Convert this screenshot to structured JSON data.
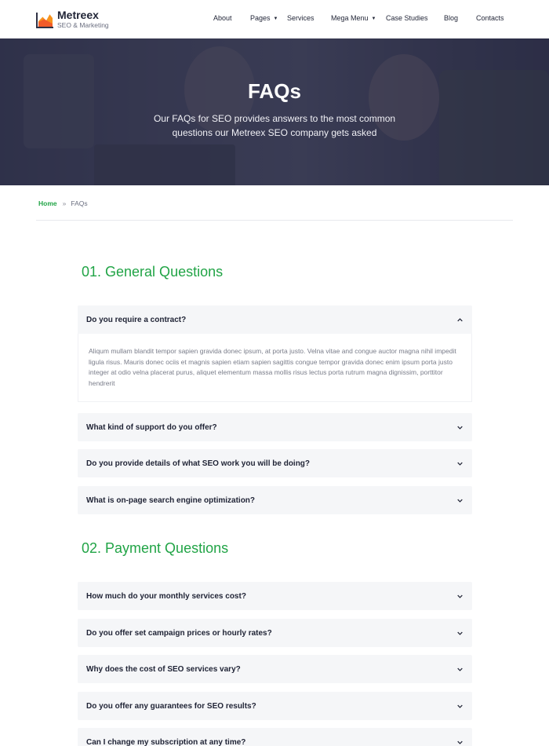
{
  "brand": {
    "title": "Metreex",
    "subtitle": "SEO & Marketing"
  },
  "nav": [
    {
      "label": "About",
      "has_caret": false
    },
    {
      "label": "Pages",
      "has_caret": true
    },
    {
      "label": "Services",
      "has_caret": false
    },
    {
      "label": "Mega Menu",
      "has_caret": true
    },
    {
      "label": "Case Studies",
      "has_caret": false
    },
    {
      "label": "Blog",
      "has_caret": false
    },
    {
      "label": "Contacts",
      "has_caret": false
    }
  ],
  "hero": {
    "title": "FAQs",
    "subtitle": "Our FAQs for SEO provides answers to the most common questions our Metreex SEO company gets asked"
  },
  "breadcrumb": {
    "home": "Home",
    "separator": "»",
    "current": "FAQs"
  },
  "sections": [
    {
      "title": "01. General Questions",
      "items": [
        {
          "question": "Do you require a contract?",
          "expanded": true,
          "answer": "Aliqum mullam blandit tempor sapien gravida donec ipsum, at porta justo. Velna vitae and congue auctor magna nihil impedit ligula risus. Mauris donec ociis et magnis sapien etiam sapien sagittis congue tempor gravida donec enim ipsum porta justo integer at odio velna placerat purus, aliquet elementum massa mollis risus lectus porta rutrum magna dignissim, porttitor hendrerit"
        },
        {
          "question": "What kind of support do you offer?",
          "expanded": false
        },
        {
          "question": "Do you provide details of what SEO work you will be doing?",
          "expanded": false
        },
        {
          "question": "What is on-page search engine optimization?",
          "expanded": false
        }
      ]
    },
    {
      "title": "02. Payment Questions",
      "items": [
        {
          "question": "How much do your monthly services cost?",
          "expanded": false
        },
        {
          "question": "Do you offer set campaign prices or hourly rates?",
          "expanded": false
        },
        {
          "question": "Why does the cost of SEO services vary?",
          "expanded": false
        },
        {
          "question": "Do you offer any guarantees for SEO results?",
          "expanded": false
        },
        {
          "question": "Can I change my subscription at any time?",
          "expanded": false
        }
      ]
    }
  ],
  "colors": {
    "accent": "#21a446",
    "faq_bg": "#f5f6f8",
    "hero_overlay": "#26284a"
  }
}
